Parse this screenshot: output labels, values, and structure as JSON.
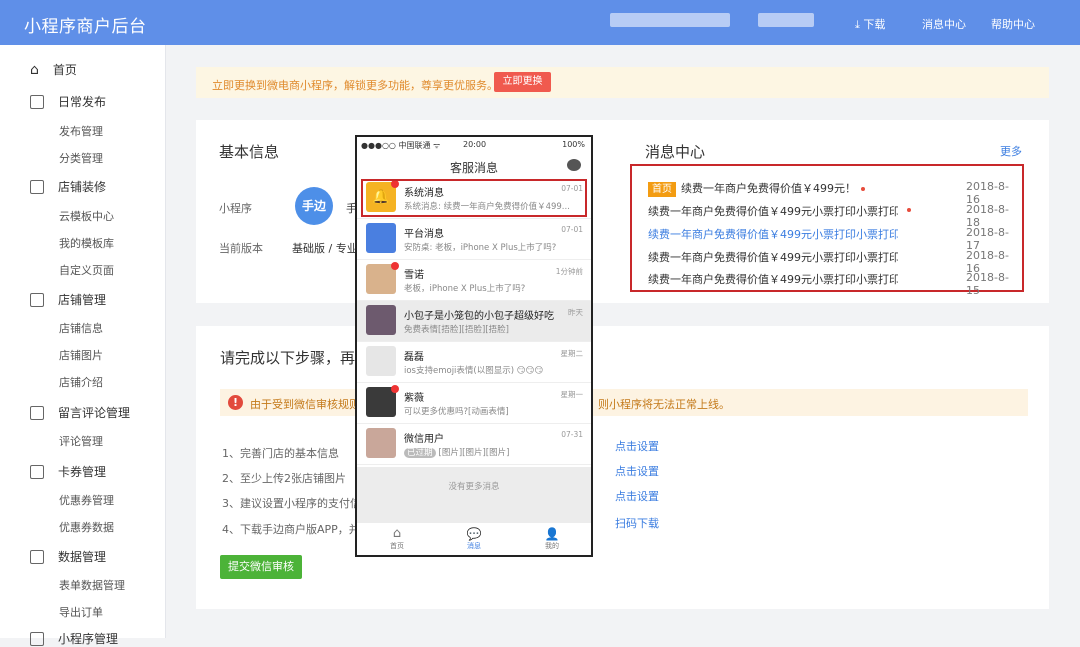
{
  "topbar": {
    "brand": "小程序商户后台",
    "download": "下载",
    "msg_center": "消息中心",
    "help": "帮助中心"
  },
  "sidebar": {
    "home": "首页",
    "daily": {
      "label": "日常发布",
      "items": [
        "发布管理",
        "分类管理"
      ]
    },
    "shop_deco": {
      "label": "店铺装修",
      "items": [
        "云模板中心",
        "我的模板库",
        "自定义页面"
      ]
    },
    "shop_mgmt": {
      "label": "店铺管理",
      "items": [
        "店铺信息",
        "店铺图片",
        "店铺介绍"
      ]
    },
    "comments": {
      "label": "留言评论管理",
      "items": [
        "评论管理"
      ]
    },
    "cards": {
      "label": "卡券管理",
      "items": [
        "优惠券管理",
        "优惠券数据"
      ]
    },
    "data": {
      "label": "数据管理",
      "items": [
        "表单数据管理",
        "导出订单"
      ]
    },
    "mini": {
      "label": "小程序管理"
    }
  },
  "notice": {
    "text": "立即更换到微电商小程序，解锁更多功能，尊享更优服务。",
    "button": "立即更换"
  },
  "basic": {
    "title": "基本信息",
    "program_label": "小程序",
    "logo_text": "手边",
    "program_name": "手",
    "version_label": "当前版本",
    "version_value": "基础版 / 专业"
  },
  "messages": {
    "title": "消息中心",
    "more": "更多",
    "tag": "首页",
    "items": [
      {
        "text": "续费一年商户免费得价值￥499元！",
        "date": "2018-8-16"
      },
      {
        "text": "续费一年商户免费得价值￥499元小票打印小票打印...",
        "date": "2018-8-18"
      },
      {
        "text": "续费一年商户免费得价值￥499元小票打印小票打印...",
        "date": "2018-8-17"
      },
      {
        "text": "续费一年商户免费得价值￥499元小票打印小票打印...",
        "date": "2018-8-16"
      },
      {
        "text": "续费一年商户免费得价值￥499元小票打印小票打印...",
        "date": "2018-8-15"
      }
    ]
  },
  "steps": {
    "title": "请完成以下步骤，再",
    "warning_left": "由于受到微信审核规则",
    "warning_right": "则小程序将无法正常上线。",
    "items": [
      "1、完善门店的基本信息",
      "2、至少上传2张店铺图片",
      "3、建议设置小程序的支付信",
      "4、下载手边商户版APP，并允"
    ],
    "links": [
      "点击设置",
      "点击设置",
      "点击设置",
      "扫码下载"
    ],
    "submit": "提交微信审核"
  },
  "phone": {
    "carrier": "●●●○○ 中国联通 ᯤ",
    "time": "20:00",
    "battery": "100%",
    "title": "客服消息",
    "chats": [
      {
        "name": "系统消息",
        "desc": "系统消息: 续费一年商户免费得价值￥499...",
        "time": "07-01"
      },
      {
        "name": "平台消息",
        "desc": "安防桌: 老板，iPhone X Plus上市了吗?",
        "time": "07-01"
      },
      {
        "name": "雪诺",
        "desc": "老板，iPhone X Plus上市了吗?",
        "time": "1分钟前"
      },
      {
        "name": "小包子是小笼包的小包子超级好吃",
        "desc": "免费表情[捂脸][捂脸][捂脸]",
        "time": "昨天"
      },
      {
        "name": "磊磊",
        "desc": "ios支持emoji表情(以图显示) 😏😏😏",
        "time": "星期二"
      },
      {
        "name": "紫薇",
        "desc": "可以更多优惠吗?[动画表情]",
        "time": "星期一"
      },
      {
        "name": "微信用户",
        "desc": "[图片][图片][图片]",
        "time": "07-31",
        "tag": "已过期"
      }
    ],
    "no_more": "没有更多消息",
    "tabs": [
      "首页",
      "消息",
      "我的"
    ]
  }
}
